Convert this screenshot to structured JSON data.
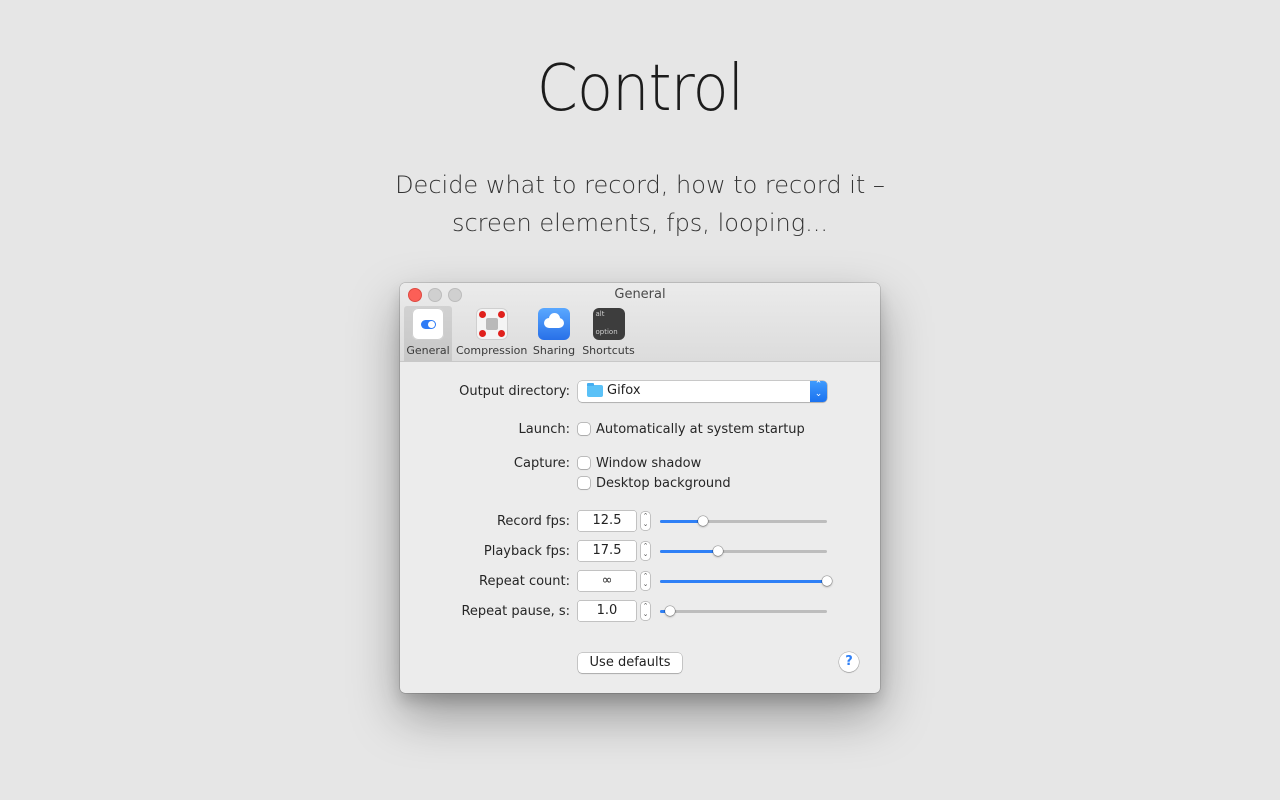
{
  "hero": {
    "title": "Control",
    "subtitle_line1": "Decide what to record, how to record it –",
    "subtitle_line2": "screen elements, fps, looping..."
  },
  "window": {
    "title": "General",
    "tabs": [
      {
        "label": "General",
        "icon": "toggle-icon"
      },
      {
        "label": "Compression",
        "icon": "compression-icon"
      },
      {
        "label": "Sharing",
        "icon": "cloud-icon"
      },
      {
        "label": "Shortcuts",
        "icon": "keyboard-icon",
        "key_top": "alt",
        "key_bottom": "option"
      }
    ],
    "output_directory": {
      "label": "Output directory:",
      "value": "Gifox"
    },
    "launch": {
      "label": "Launch:",
      "option": "Automatically at system startup",
      "checked": false
    },
    "capture": {
      "label": "Capture:",
      "options": [
        {
          "label": "Window shadow",
          "checked": false
        },
        {
          "label": "Desktop background",
          "checked": false
        }
      ]
    },
    "sliders": [
      {
        "label": "Record fps:",
        "value": "12.5",
        "level": 0.26
      },
      {
        "label": "Playback fps:",
        "value": "17.5",
        "level": 0.35
      },
      {
        "label": "Repeat count:",
        "value": "∞",
        "level": 1.0
      },
      {
        "label": "Repeat pause, s:",
        "value": "1.0",
        "level": 0.06
      }
    ],
    "use_defaults_label": "Use defaults",
    "help_label": "?"
  },
  "colors": {
    "accent": "#2f80f6",
    "close_button": "#fc5f57",
    "page_bg": "#e6e6e6"
  }
}
